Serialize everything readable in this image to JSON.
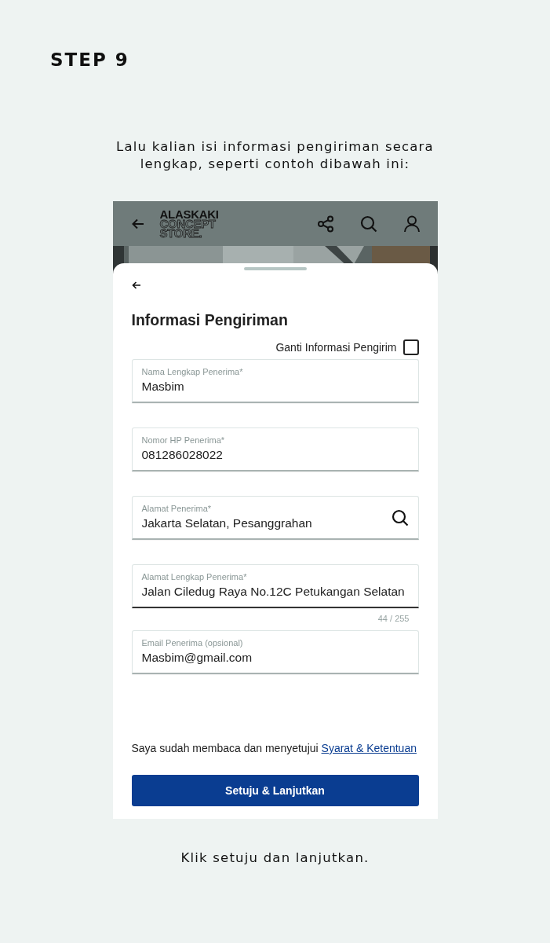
{
  "step_title": "STEP 9",
  "instruction": "Lalu kalian isi informasi pengiriman secara lengkap, seperti contoh dibawah ini:",
  "app": {
    "logo_lines": [
      "ALASKAKI",
      "CONCEPT",
      "STORE."
    ],
    "sheet": {
      "title": "Informasi Pengiriman",
      "sender_toggle": {
        "label": "Ganti Informasi Pengirim",
        "checked": false
      },
      "fields": [
        {
          "label": "Nama Lengkap Penerima*",
          "value": "Masbim"
        },
        {
          "label": "Nomor HP Penerima*",
          "value": "081286028022"
        },
        {
          "label": "Alamat Penerima*",
          "value": "Jakarta Selatan, Pesanggrahan",
          "kind": "search"
        },
        {
          "label": "Alamat Lengkap Penerima*",
          "value": "Jalan Ciledug Raya No.12C Petukangan Selatan",
          "counter": "44 / 255",
          "focused": true
        },
        {
          "label": "Email Penerima (opsional)",
          "value": "Masbim@gmail.com"
        }
      ],
      "terms_text": "Saya sudah membaca dan menyetujui",
      "terms_link": "Syarat & Ketentuan",
      "submit": "Setuju & Lanjutkan"
    }
  },
  "caption": "Klik setuju dan lanjutkan."
}
